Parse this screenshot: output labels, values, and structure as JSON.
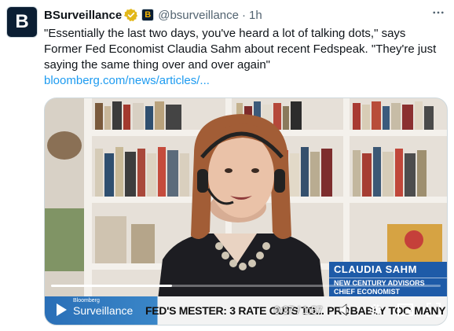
{
  "author": {
    "avatar_letter": "B",
    "name": "BSurveillance",
    "affiliate_letter": "B",
    "handle": "@bsurveillance",
    "separator": "·",
    "time": "1h"
  },
  "tweet": {
    "text": "\"Essentially the last two days, you've heard a lot of talking dots,\" says Former Fed Economist Claudia Sahm about recent Fedspeak. \"They're just saying the same thing over and over again\"",
    "link": "bloomberg.com/news/articles/..."
  },
  "video": {
    "lower_third_name": "CLAUDIA SAHM",
    "lower_third_org": "NEW CENTURY ADVISORS",
    "lower_third_title": "CHIEF ECONOMIST",
    "brand_small": "Bloomberg",
    "brand_big": "Surveillance",
    "headline": "FED'S MESTER: 3 RATE CUTS TO... PROBABLY TOO MANY",
    "timestamp": "0:37 / 1:57",
    "progress": 0.31
  },
  "colors": {
    "accent_link": "#1d9bf0",
    "verified_gold": "#e2b719",
    "lower_third_blue": "#1e5ba8"
  },
  "icons": [
    "more-icon",
    "verified-icon",
    "play-icon",
    "volume-icon",
    "settings-icon",
    "pip-icon",
    "fullscreen-icon"
  ]
}
